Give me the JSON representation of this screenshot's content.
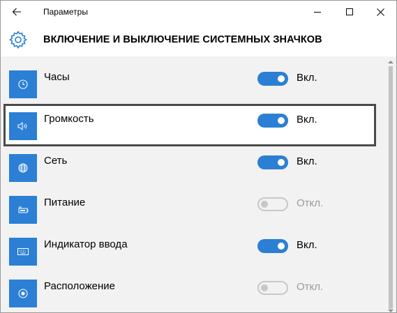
{
  "titlebar": {
    "app_title": "Параметры",
    "back_icon": "arrow-left-icon",
    "minimize_icon": "minimize-icon",
    "maximize_icon": "maximize-icon",
    "close_icon": "close-icon"
  },
  "header": {
    "icon": "gear-icon",
    "title": "ВКЛЮЧЕНИЕ И ВЫКЛЮЧЕНИЕ СИСТЕМНЫХ ЗНАЧКОВ"
  },
  "colors": {
    "accent": "#2b7fd4",
    "content_bg": "#f2f2f2",
    "off_text": "#9a9a9a",
    "highlight_border": "#4a4a4a"
  },
  "items": [
    {
      "label": "Часы",
      "icon": "clock-icon",
      "on": true,
      "state": "Вкл."
    },
    {
      "label": "Громкость",
      "icon": "volume-icon",
      "on": true,
      "state": "Вкл.",
      "highlighted": true
    },
    {
      "label": "Сеть",
      "icon": "network-icon",
      "on": true,
      "state": "Вкл."
    },
    {
      "label": "Питание",
      "icon": "battery-icon",
      "on": false,
      "state": "Откл."
    },
    {
      "label": "Индикатор ввода",
      "icon": "keyboard-icon",
      "on": true,
      "state": "Вкл."
    },
    {
      "label": "Расположение",
      "icon": "location-icon",
      "on": false,
      "state": "Откл."
    }
  ]
}
